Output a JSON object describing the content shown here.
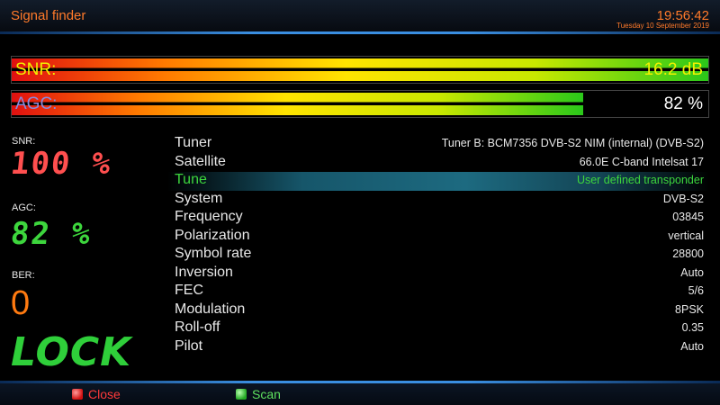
{
  "header": {
    "title": "Signal finder",
    "time": "19:56:42",
    "date": "Tuesday 10 September 2019"
  },
  "meters": {
    "snr": {
      "label": "SNR:",
      "value": "16.2 dB",
      "fill_fraction": 1.0
    },
    "agc": {
      "label": "AGC:",
      "value": "82 %",
      "fill_fraction": 0.82
    }
  },
  "readouts": {
    "snr_label": "SNR:",
    "snr_value": "100 %",
    "agc_label": "AGC:",
    "agc_value": "82 %",
    "ber_label": "BER:",
    "ber_value": "0",
    "lock_status": "LOCK"
  },
  "info_rows": [
    {
      "key": "Tuner",
      "value": "Tuner B: BCM7356 DVB-S2 NIM (internal) (DVB-S2)",
      "selected": false
    },
    {
      "key": "Satellite",
      "value": "66.0E C-band Intelsat 17",
      "selected": false
    },
    {
      "key": "Tune",
      "value": "User defined transponder",
      "selected": true
    },
    {
      "key": "System",
      "value": "DVB-S2",
      "selected": false
    },
    {
      "key": "Frequency",
      "value": "03845",
      "selected": false
    },
    {
      "key": "Polarization",
      "value": "vertical",
      "selected": false
    },
    {
      "key": "Symbol rate",
      "value": "28800",
      "selected": false
    },
    {
      "key": "Inversion",
      "value": "Auto",
      "selected": false
    },
    {
      "key": "FEC",
      "value": "5/6",
      "selected": false
    },
    {
      "key": "Modulation",
      "value": "8PSK",
      "selected": false
    },
    {
      "key": "Roll-off",
      "value": "0.35",
      "selected": false
    },
    {
      "key": "Pilot",
      "value": "Auto",
      "selected": false
    }
  ],
  "footer": {
    "close_label": "Close",
    "close_key_color": "#d01010",
    "scan_label": "Scan",
    "scan_key_color": "#22a822"
  },
  "colors": {
    "accent": "#ff7a2a",
    "selected_text": "#3dd63d",
    "snr_readout": "#ff4f4f",
    "agc_readout": "#3dd63d",
    "ber_readout": "#ff7a10"
  }
}
